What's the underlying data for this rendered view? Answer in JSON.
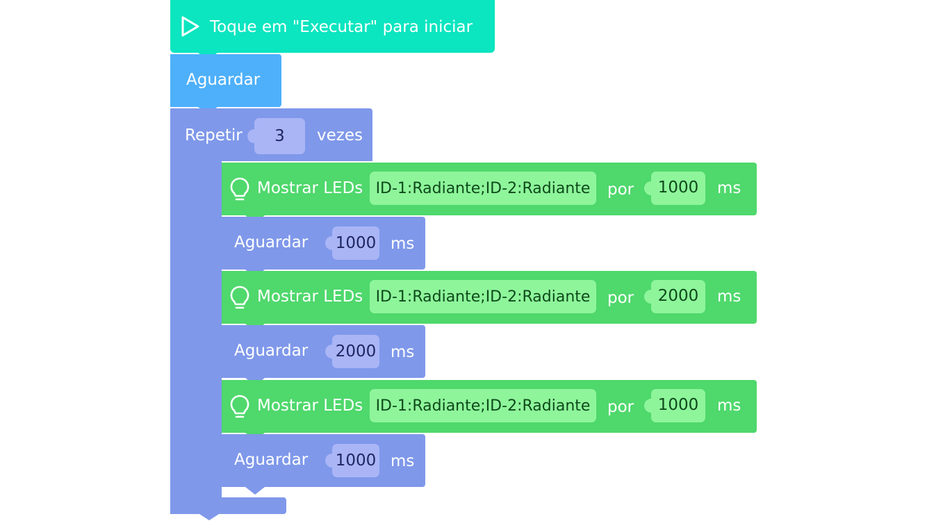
{
  "colors": {
    "start": "#0be5c0",
    "wait": "#4eb0fb",
    "loop": "#7f98ea",
    "led": "#4fd86c",
    "pill_green": "#8ef59b",
    "pill_purple": "#aab5f6"
  },
  "start_block": {
    "icon": "play-icon",
    "label": "Toque em \"Executar\" para iniciar"
  },
  "wait_block": {
    "label": "Aguardar"
  },
  "repeat_block": {
    "label": "Repetir",
    "count": "3",
    "suffix": "vezes"
  },
  "steps": [
    {
      "type": "show_leds",
      "icon": "lightbulb-icon",
      "label": "Mostrar LEDs",
      "leds": "ID-1:Radiante;ID-2:Radiante",
      "por": "por",
      "duration": "1000",
      "unit": "ms"
    },
    {
      "type": "wait",
      "label": "Aguardar",
      "duration": "1000",
      "unit": "ms"
    },
    {
      "type": "show_leds",
      "icon": "lightbulb-icon",
      "label": "Mostrar LEDs",
      "leds": "ID-1:Radiante;ID-2:Radiante",
      "por": "por",
      "duration": "2000",
      "unit": "ms"
    },
    {
      "type": "wait",
      "label": "Aguardar",
      "duration": "2000",
      "unit": "ms"
    },
    {
      "type": "show_leds",
      "icon": "lightbulb-icon",
      "label": "Mostrar LEDs",
      "leds": "ID-1:Radiante;ID-2:Radiante",
      "por": "por",
      "duration": "1000",
      "unit": "ms"
    },
    {
      "type": "wait",
      "label": "Aguardar",
      "duration": "1000",
      "unit": "ms"
    }
  ]
}
